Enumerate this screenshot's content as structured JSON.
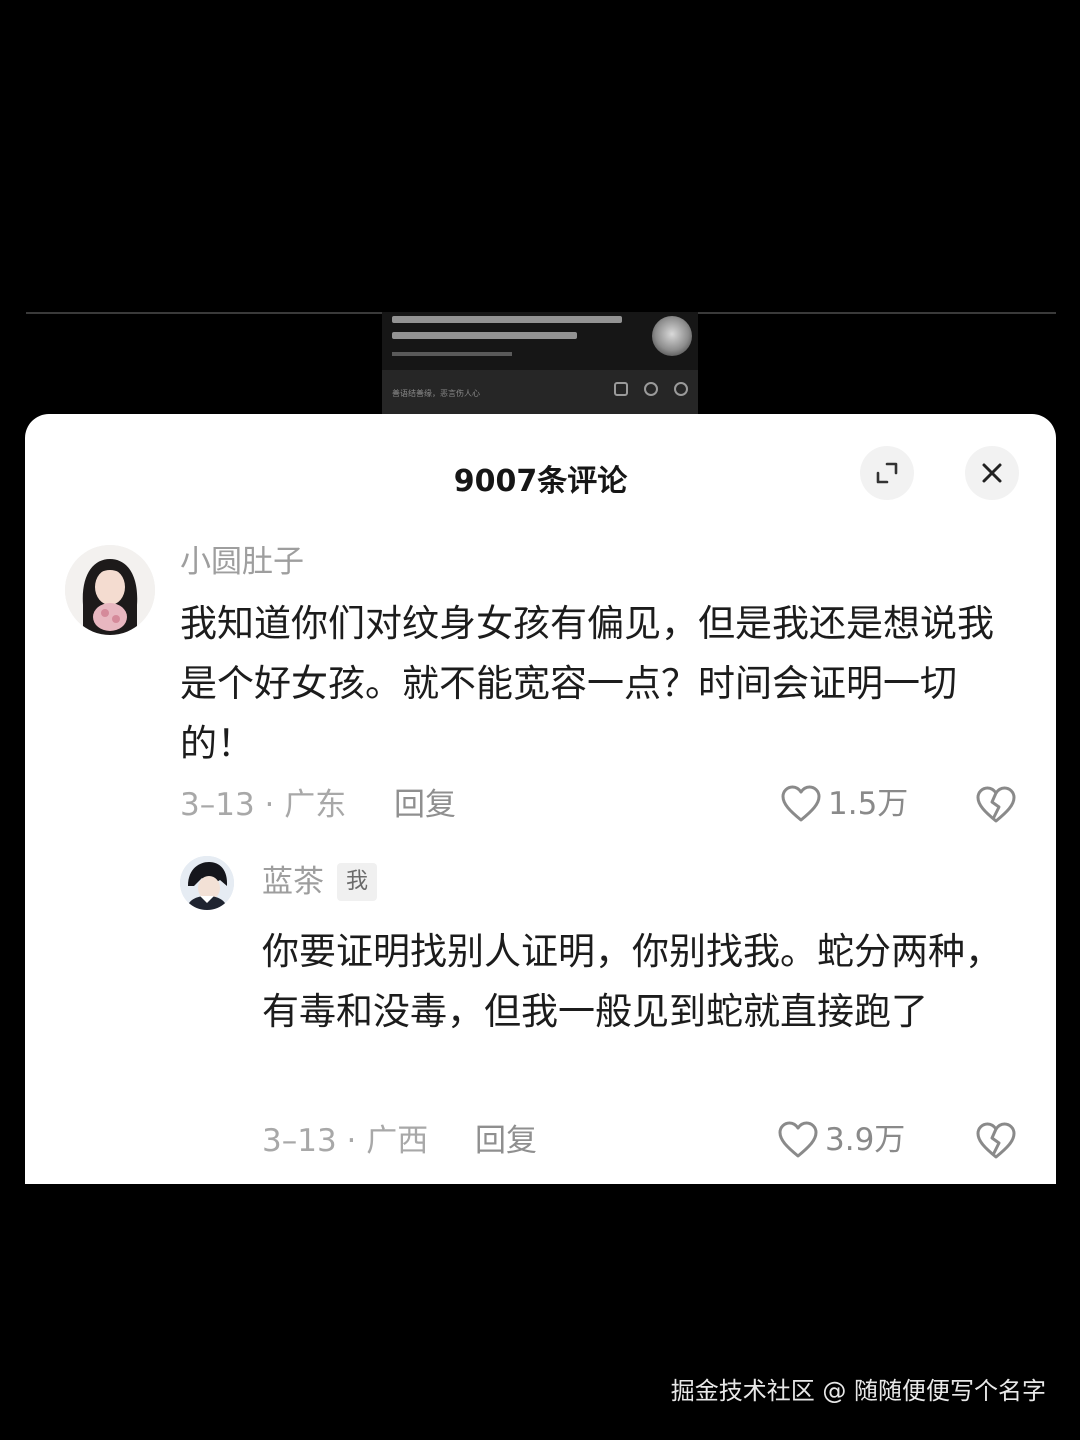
{
  "background": {
    "input_placeholder": "善语结善缘，恶言伤人心"
  },
  "sheet": {
    "title": "9007条评论"
  },
  "comments": [
    {
      "username": "小圆肚子",
      "text": "我知道你们对纹身女孩有偏见，但是我还是想说我是个好女孩。就不能宽容一点？时间会证明一切的！",
      "meta": "3–13 · 广东",
      "reply_label": "回复",
      "likes": "1.5万"
    },
    {
      "username": "蓝茶",
      "badge": "我",
      "text": "你要证明找别人证明，你别找我。蛇分两种，有毒和没毒，但我一般见到蛇就直接跑了",
      "meta": "3–13 · 广西",
      "reply_label": "回复",
      "likes": "3.9万"
    }
  ],
  "watermark": "掘金技术社区 @ 随随便便写个名字",
  "colors": {
    "background": "#000000",
    "sheet": "#ffffff",
    "title": "#161616",
    "text": "#1c1c1c",
    "muted": "#a8a8a8"
  },
  "icons": [
    "expand-icon",
    "close-icon",
    "heart-icon",
    "broken-heart-icon"
  ]
}
